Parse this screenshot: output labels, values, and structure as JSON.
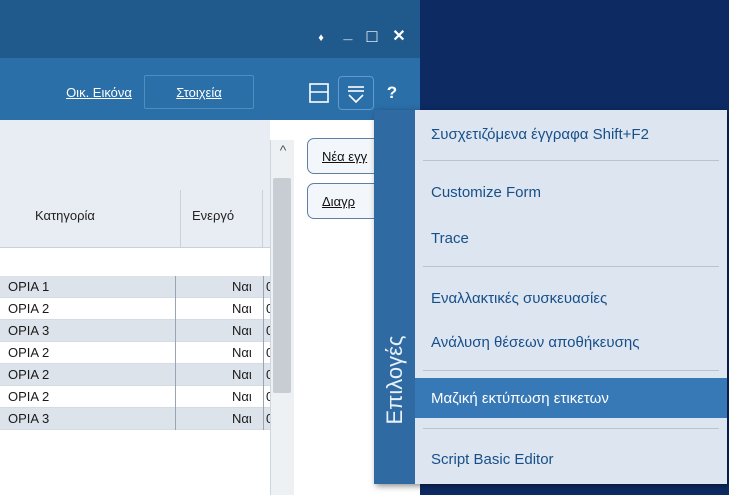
{
  "window_controls": {
    "pin": "♦",
    "minimize": "_",
    "maximize": "□",
    "close": "✕"
  },
  "toolbar": {
    "oik_eikona": "Οικ. Εικόνα",
    "stoixeia": "Στοιχεία",
    "layout_icon": "layout-icon",
    "options_icon": "options-icon",
    "help": "?"
  },
  "grid": {
    "headers": {
      "category": "Κατηγορία",
      "active": "Ενεργό"
    },
    "scroll_up": "^",
    "rows": [
      {
        "category": "ΟΡΙΑ 1",
        "active": "Ναι",
        "next": "0"
      },
      {
        "category": "ΟΡΙΑ 2",
        "active": "Ναι",
        "next": "0"
      },
      {
        "category": "ΟΡΙΑ 3",
        "active": "Ναι",
        "next": "0"
      },
      {
        "category": "ΟΡΙΑ 2",
        "active": "Ναι",
        "next": "0"
      },
      {
        "category": "ΟΡΙΑ 2",
        "active": "Ναι",
        "next": "0"
      },
      {
        "category": "ΟΡΙΑ 2",
        "active": "Ναι",
        "next": "0"
      },
      {
        "category": "ΟΡΙΑ 3",
        "active": "Ναι",
        "next": "0"
      }
    ]
  },
  "side_buttons": {
    "new": "Νέα εγγ",
    "delete": "Διαγρ"
  },
  "menu": {
    "strip_label": "Επιλογές",
    "items": [
      {
        "label": "Συσχετιζόμενα έγγραφα   Shift+F2"
      },
      {
        "label": "Customize Form"
      },
      {
        "label": "Trace"
      },
      {
        "label": "Εναλλακτικές συσκευασίες"
      },
      {
        "label": "Ανάλυση θέσεων αποθήκευσης"
      },
      {
        "label": "Μαζική εκτύπωση ετικετων"
      },
      {
        "label": "Script Basic Editor"
      }
    ],
    "selected_index": 5
  },
  "colors": {
    "titlebar": "#205a8c",
    "toolbar": "#2a6fa8",
    "dark": "#0d2a63",
    "menu_bg": "#dde6f0",
    "selected": "#3778b6",
    "menu_text": "#174f8a"
  }
}
